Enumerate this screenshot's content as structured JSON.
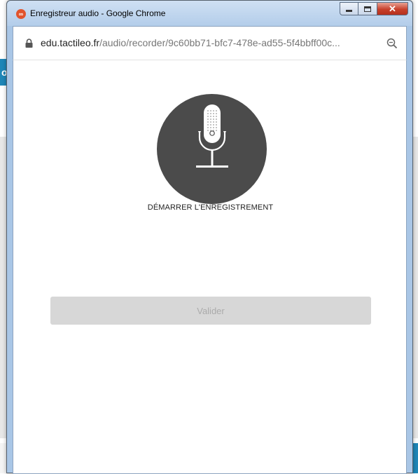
{
  "background": {
    "left_tab_text": "o"
  },
  "window": {
    "title": "Enregistreur audio - Google Chrome",
    "app_icon_glyph": "∞",
    "controls": {
      "minimize": "minimize-icon",
      "maximize": "maximize-icon",
      "close_glyph": "✕"
    }
  },
  "address": {
    "host": "edu.tactileo.fr",
    "path": "/audio/recorder/9c60bb71-bfc7-478e-ad55-5f4bbff00c..."
  },
  "recorder": {
    "start_label": "DÉMARRER L'ENREGISTREMENT",
    "validate_label": "Valider",
    "validate_enabled": false
  },
  "colors": {
    "mic_circle": "#4b4b4b",
    "validate_bg": "#d7d7d7",
    "validate_text": "#ababab",
    "accent_blue": "#1e86b7"
  }
}
